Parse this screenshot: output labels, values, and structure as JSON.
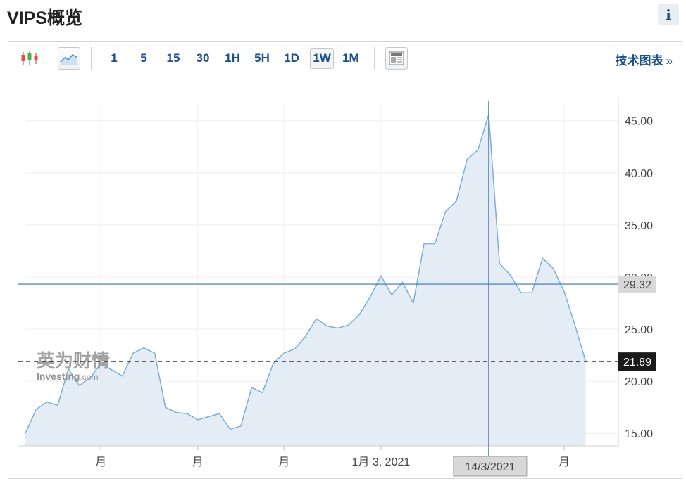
{
  "header": {
    "title": "VIPS概览",
    "info_label": "i"
  },
  "toolbar": {
    "intervals": [
      "1",
      "5",
      "15",
      "30",
      "1H",
      "5H",
      "1D",
      "1W",
      "1M"
    ],
    "active_interval": "1W",
    "tech_chart_label": "技术图表",
    "tech_chart_arrow": "»"
  },
  "watermark": {
    "cn": "英为财情",
    "en": "Investing",
    "en_suffix": ".com"
  },
  "colors": {
    "line": "#7eaed3",
    "area": "#e4edf5",
    "crosshair": "#3b73b0",
    "last_price_bg": "#1a1a1a",
    "hover_label_bg": "#d8d8d8"
  },
  "chart_data": {
    "type": "area",
    "title": "",
    "xlabel": "",
    "ylabel": "",
    "ylim": [
      13.8,
      46.6
    ],
    "y_ticks": [
      "15.00",
      "20.00",
      "25.00",
      "30.00",
      "35.00",
      "40.00",
      "45.00"
    ],
    "x_tick_labels": [
      "月",
      "月",
      "月",
      "1月 3, 2021",
      "月",
      "月"
    ],
    "x_tick_indices": [
      7,
      16,
      24,
      33,
      42,
      50
    ],
    "grid": true,
    "series": [
      {
        "values": [
          15.0,
          17.3,
          18.0,
          17.7,
          21.2,
          19.6,
          20.3,
          21.7,
          21.1,
          20.5,
          22.7,
          23.2,
          22.7,
          17.5,
          17.0,
          16.9,
          16.3,
          16.6,
          16.9,
          15.4,
          15.7,
          19.4,
          18.9,
          21.7,
          22.7,
          23.1,
          24.3,
          26.0,
          25.3,
          25.1,
          25.4,
          26.4,
          28.1,
          30.1,
          28.3,
          29.5,
          27.5,
          33.2,
          33.2,
          36.3,
          37.3,
          41.3,
          42.2,
          45.6,
          31.3,
          30.2,
          28.5,
          28.5,
          31.8,
          30.8,
          28.6,
          25.4,
          21.89
        ]
      }
    ],
    "horizontal_line": {
      "value": 29.32,
      "label": "29.32"
    },
    "last_price": {
      "value": 21.89,
      "label": "21.89"
    },
    "crosshair": {
      "index": 43,
      "date_label": "14/3/2021"
    }
  }
}
